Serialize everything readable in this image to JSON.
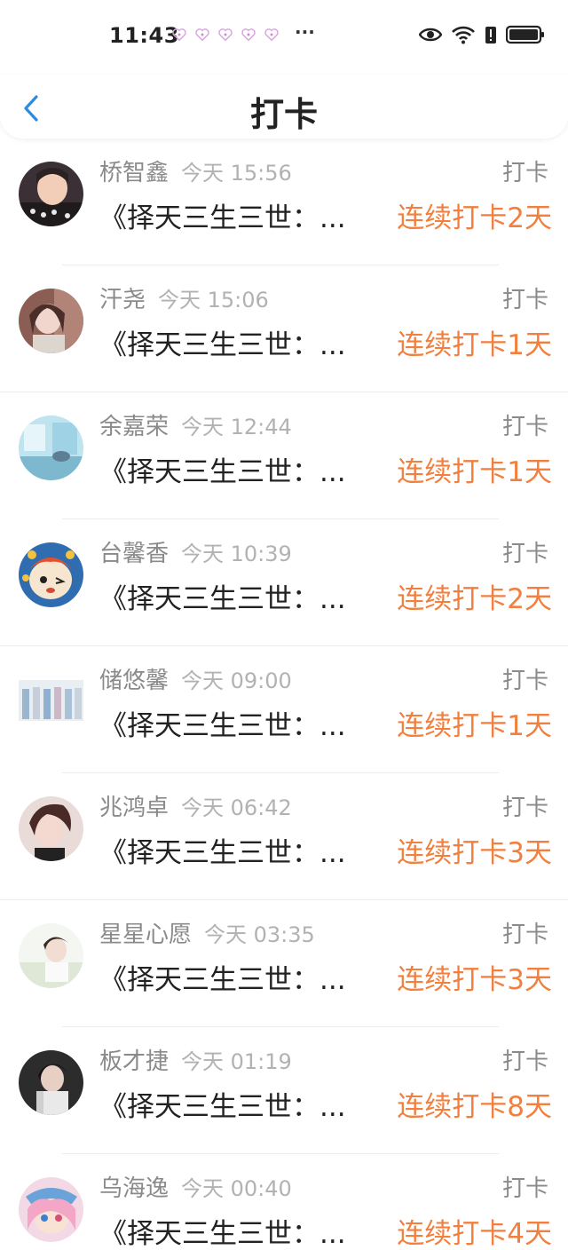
{
  "status_bar": {
    "time": "11:43",
    "more": "···",
    "notification_icons": [
      "heart-notif-icon",
      "heart-notif-icon",
      "heart-notif-icon",
      "heart-notif-icon",
      "heart-notif-icon"
    ],
    "right_icons": [
      "eye-icon",
      "wifi-icon",
      "battery-alert-icon",
      "battery-icon"
    ]
  },
  "nav": {
    "back_icon": "chevron-left-icon",
    "title": "打卡"
  },
  "colors": {
    "accent": "#f27f3d",
    "back_icon": "#2a8bdf"
  },
  "items": [
    {
      "name": "桥智鑫",
      "time": "今天 15:56",
      "kind": "打卡",
      "book": "《择天三生三世：...",
      "streak": "连续打卡2天"
    },
    {
      "name": "汗尧",
      "time": "今天 15:06",
      "kind": "打卡",
      "book": "《择天三生三世：...",
      "streak": "连续打卡1天"
    },
    {
      "name": "余嘉荣",
      "time": "今天 12:44",
      "kind": "打卡",
      "book": "《择天三生三世：...",
      "streak": "连续打卡1天"
    },
    {
      "name": "台馨香",
      "time": "今天 10:39",
      "kind": "打卡",
      "book": "《择天三生三世：...",
      "streak": "连续打卡2天"
    },
    {
      "name": "储悠馨",
      "time": "今天 09:00",
      "kind": "打卡",
      "book": "《择天三生三世：...",
      "streak": "连续打卡1天"
    },
    {
      "name": "兆鸿卓",
      "time": "今天 06:42",
      "kind": "打卡",
      "book": "《择天三生三世：...",
      "streak": "连续打卡3天"
    },
    {
      "name": "星星心愿",
      "time": "今天 03:35",
      "kind": "打卡",
      "book": "《择天三生三世：...",
      "streak": "连续打卡3天"
    },
    {
      "name": "板才捷",
      "time": "今天 01:19",
      "kind": "打卡",
      "book": "《择天三生三世：...",
      "streak": "连续打卡8天"
    },
    {
      "name": "乌海逸",
      "time": "今天 00:40",
      "kind": "打卡",
      "book": "《择天三生三世：...",
      "streak": "连续打卡4天"
    }
  ]
}
